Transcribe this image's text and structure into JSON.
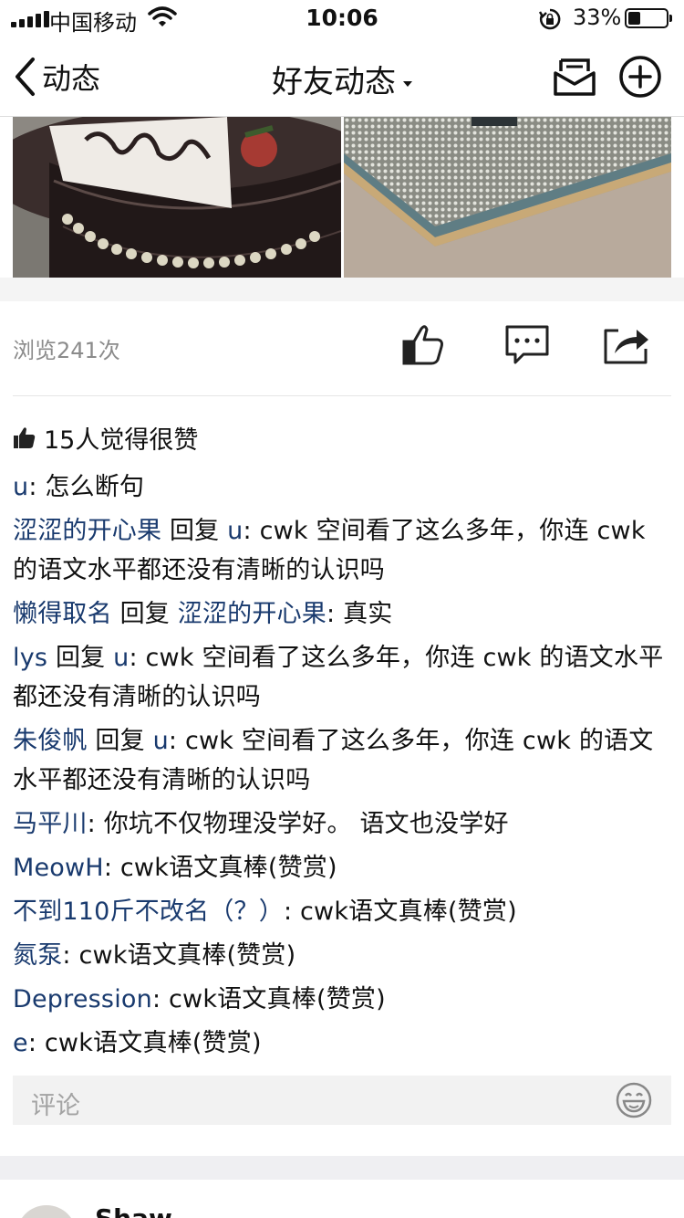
{
  "status_bar": {
    "carrier": "中国移动",
    "time": "10:06",
    "battery_percent": "33%",
    "battery_level": 0.33,
    "icons": [
      "signal-icon",
      "wifi-icon",
      "orientation-lock-icon",
      "battery-icon"
    ]
  },
  "nav": {
    "back_label": "动态",
    "title": "好友动态",
    "icons": [
      "back-chevron-icon",
      "caret-down-icon",
      "mail-icon",
      "add-circle-icon"
    ]
  },
  "post": {
    "photos": [
      "cake-photo",
      "cpu-chip-photo"
    ],
    "views": "浏览241次",
    "actions": [
      "thumbs-up-icon",
      "comment-bubble-icon",
      "share-icon"
    ],
    "likes_text": "15人觉得很赞",
    "comments": [
      {
        "user": "u",
        "text": ": 怎么断句"
      },
      {
        "user": "涩涩的开心果",
        "reply_word": " 回复 ",
        "reply_to": "u",
        "text": ": cwk 空间看了这么多年，你连 cwk 的语文水平都还没有清晰的认识吗"
      },
      {
        "user": "懒得取名",
        "reply_word": " 回复 ",
        "reply_to": "涩涩的开心果",
        "text": ": 真实"
      },
      {
        "user": "lys",
        "reply_word": " 回复 ",
        "reply_to": "u",
        "text": ": cwk 空间看了这么多年，你连 cwk 的语文水平都还没有清晰的认识吗"
      },
      {
        "user": "朱俊帆",
        "reply_word": " 回复 ",
        "reply_to": "u",
        "text": ": cwk 空间看了这么多年，你连 cwk 的语文水平都还没有清晰的认识吗"
      },
      {
        "user": "马平川",
        "text": ": 你坑不仅物理没学好。 语文也没学好"
      },
      {
        "user": "MeowH",
        "text": ": cwk语文真棒(赞赏)"
      },
      {
        "user": "不到110斤不改名（？）",
        "text": ": cwk语文真棒(赞赏)"
      },
      {
        "user": "氮泵",
        "text": ": cwk语文真棒(赞赏)"
      },
      {
        "user": "Depression",
        "text": ": cwk语文真棒(赞赏)"
      },
      {
        "user": "e",
        "text": ": cwk语文真棒(赞赏)"
      }
    ],
    "comment_placeholder": "评论",
    "emoji_icon": "emoji-face-icon"
  },
  "next_post": {
    "name": "Shaw",
    "close_icon": "close-icon"
  },
  "colors": {
    "username": "#193a6e",
    "muted": "#8b8b8b",
    "input_bg": "#f2f2f2"
  }
}
